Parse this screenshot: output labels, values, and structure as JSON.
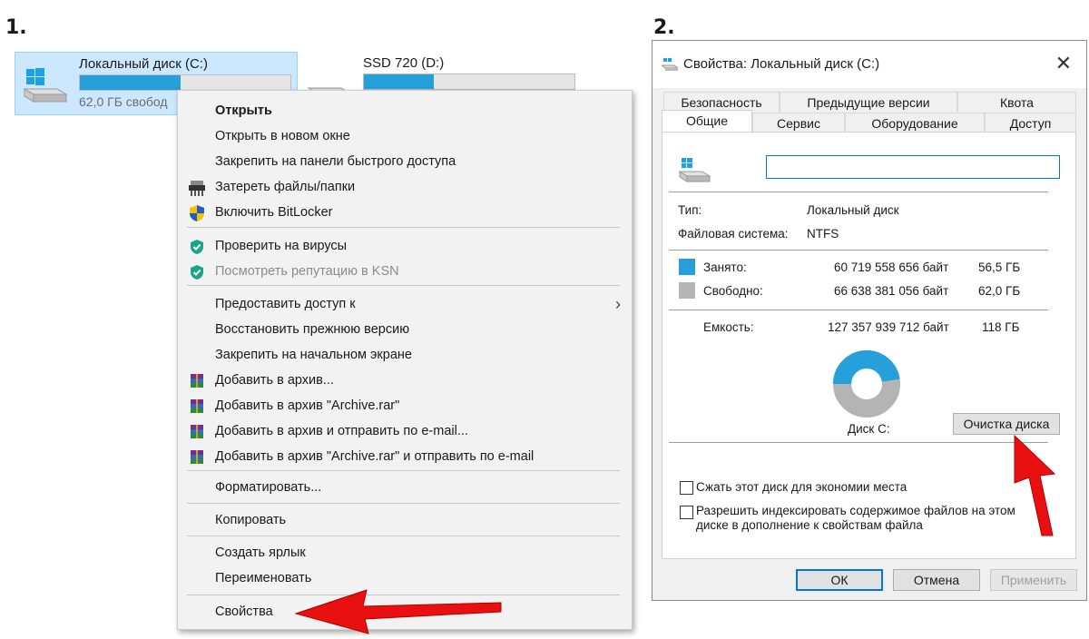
{
  "step1_label": "1.",
  "step2_label": "2.",
  "drives": [
    {
      "name": "Локальный диск (C:)",
      "free_text": "62,0 ГБ свобод",
      "used_fraction": 0.48,
      "icon": "windows-drive-icon"
    },
    {
      "name": "SSD 720 (D:)",
      "used_fraction": 0.33,
      "icon": "drive-icon"
    }
  ],
  "context_menu": {
    "open": "Открыть",
    "open_new_window": "Открыть в новом окне",
    "pin_quick_access": "Закрепить на панели быстрого доступа",
    "shred_files": "Затереть файлы/папки",
    "bitlocker": "Включить BitLocker",
    "scan_virus": "Проверить на вирусы",
    "ksn_reputation": "Посмотреть репутацию в KSN",
    "give_access": "Предоставить доступ к",
    "restore_version": "Восстановить прежнюю версию",
    "pin_start": "Закрепить на начальном экране",
    "add_archive": "Добавить в архив...",
    "add_archive_rar": "Добавить в архив \"Archive.rar\"",
    "add_archive_email": "Добавить в архив и отправить по e-mail...",
    "add_archive_rar_email": "Добавить в архив \"Archive.rar\" и отправить по e-mail",
    "format": "Форматировать...",
    "copy": "Копировать",
    "create_shortcut": "Создать ярлык",
    "rename": "Переименовать",
    "properties": "Свойства"
  },
  "dialog": {
    "title": "Свойства: Локальный диск (C:)",
    "tabs_row1": [
      "Безопасность",
      "Предыдущие версии",
      "Квота"
    ],
    "tabs_row2": [
      "Общие",
      "Сервис",
      "Оборудование",
      "Доступ"
    ],
    "name_value": "",
    "type_label": "Тип:",
    "type_value": "Локальный диск",
    "fs_label": "Файловая система:",
    "fs_value": "NTFS",
    "used_label": "Занято:",
    "used_bytes": "60 719 558 656 байт",
    "used_gb": "56,5 ГБ",
    "free_label": "Свободно:",
    "free_bytes": "66 638 381 056 байт",
    "free_gb": "62,0 ГБ",
    "capacity_label": "Емкость:",
    "capacity_bytes": "127 357 939 712 байт",
    "capacity_gb": "118 ГБ",
    "disk_label": "Диск C:",
    "cleanup_button": "Очистка диска",
    "compress_label": "Сжать этот диск для экономии места",
    "index_label_line1": "Разрешить индексировать содержимое файлов на этом",
    "index_label_line2": "диске в дополнение к свойствам файла",
    "ok_button": "ОК",
    "cancel_button": "Отмена",
    "apply_button": "Применить",
    "used_fraction": 0.477,
    "colors": {
      "used": "#26a0da",
      "free": "#b4b4b4",
      "accent": "#0078d7",
      "arrow": "#e81010"
    }
  }
}
